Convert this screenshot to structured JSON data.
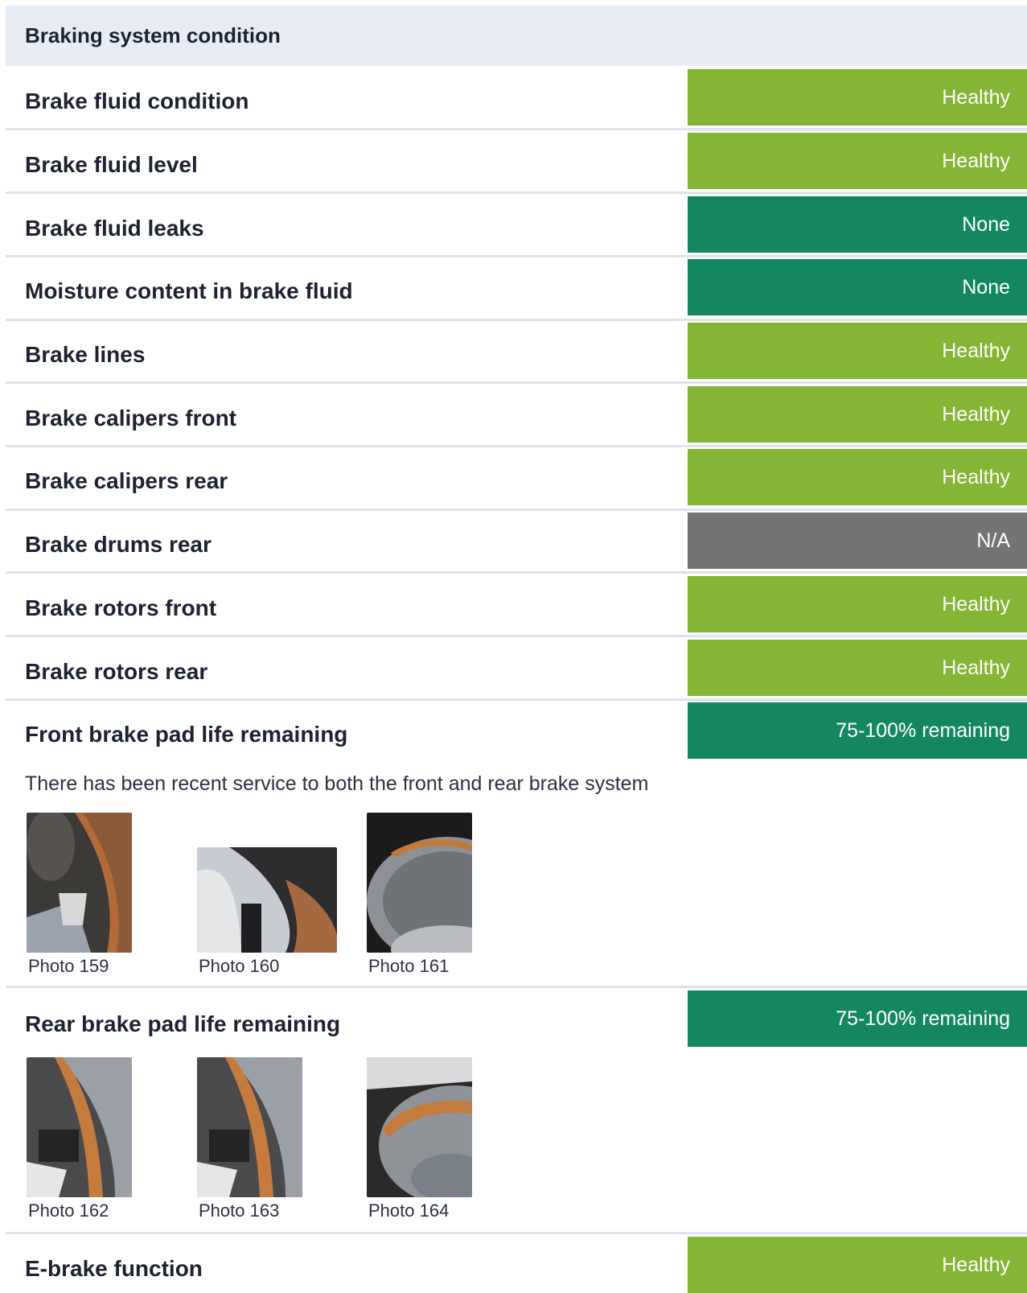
{
  "section": {
    "title": "Braking system condition"
  },
  "colors": {
    "healthy": "#84b534",
    "none": "#15875f",
    "na": "#747474",
    "remaining": "#15875f"
  },
  "rows": [
    {
      "label": "Brake fluid condition",
      "status": "Healthy",
      "kind": "healthy"
    },
    {
      "label": "Brake fluid level",
      "status": "Healthy",
      "kind": "healthy"
    },
    {
      "label": "Brake fluid leaks",
      "status": "None",
      "kind": "none"
    },
    {
      "label": "Moisture content in brake fluid",
      "status": "None",
      "kind": "none"
    },
    {
      "label": "Brake lines",
      "status": "Healthy",
      "kind": "healthy"
    },
    {
      "label": "Brake calipers front",
      "status": "Healthy",
      "kind": "healthy"
    },
    {
      "label": "Brake calipers rear",
      "status": "Healthy",
      "kind": "healthy"
    },
    {
      "label": "Brake drums rear",
      "status": "N/A",
      "kind": "na"
    },
    {
      "label": "Brake rotors front",
      "status": "Healthy",
      "kind": "healthy"
    },
    {
      "label": "Brake rotors rear",
      "status": "Healthy",
      "kind": "healthy"
    },
    {
      "label": "Front brake pad life remaining",
      "status": "75-100% remaining",
      "kind": "remaining"
    },
    {
      "label": "Rear brake pad life remaining",
      "status": "75-100% remaining",
      "kind": "remaining"
    },
    {
      "label": "E-brake function",
      "status": "Healthy",
      "kind": "healthy"
    }
  ],
  "front_pads": {
    "note": "There has been recent service to both the front and rear brake system",
    "photos": [
      {
        "caption": "Photo 159",
        "icon": "brake-photo"
      },
      {
        "caption": "Photo 160",
        "icon": "brake-photo"
      },
      {
        "caption": "Photo 161",
        "icon": "brake-photo"
      }
    ]
  },
  "rear_pads": {
    "photos": [
      {
        "caption": "Photo 162",
        "icon": "brake-photo"
      },
      {
        "caption": "Photo 163",
        "icon": "brake-photo"
      },
      {
        "caption": "Photo 164",
        "icon": "brake-photo"
      }
    ]
  }
}
